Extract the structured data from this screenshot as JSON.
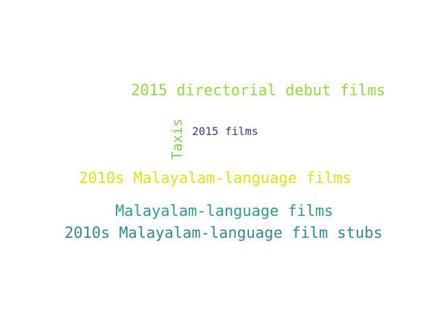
{
  "word_cloud": {
    "words": [
      {
        "text": "2015 directorial debut films",
        "color": "#95d840"
      },
      {
        "text": "2010s Malayalam-language films",
        "color": "#dde318"
      },
      {
        "text": "Malayalam-language films",
        "color": "#2f9a8f"
      },
      {
        "text": "2010s Malayalam-language film stubs",
        "color": "#34878f"
      },
      {
        "text": "2015 films",
        "color": "#46327e"
      },
      {
        "text": "Taxis",
        "color": "#7ad151"
      }
    ]
  }
}
